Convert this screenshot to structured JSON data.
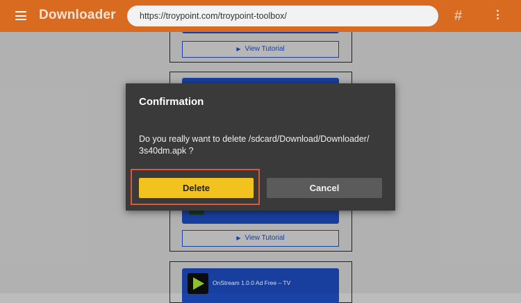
{
  "topbar": {
    "menu_icon": "hamburger-menu-icon",
    "app_name": "Downloader",
    "url": "https://troypoint.com/troypoint-toolbox/",
    "hash_label": "#",
    "more_icon": "vertical-dots-icon",
    "brand_color": "#d96b20"
  },
  "background": {
    "tutorial_label_1": "View Tutorial",
    "tutorial_label_2": "View Tutorial",
    "app_item_title": "OnStream 1.0.0 Ad Free – TV",
    "card_color": "#1a43a8"
  },
  "dialog": {
    "title": "Confirmation",
    "message": "Do you really want to delete /sdcard/Download/Downloader/ 3s40dm.apk ?",
    "delete_label": "Delete",
    "cancel_label": "Cancel",
    "delete_color": "#f2c21e",
    "highlight_color": "#e0563b"
  }
}
